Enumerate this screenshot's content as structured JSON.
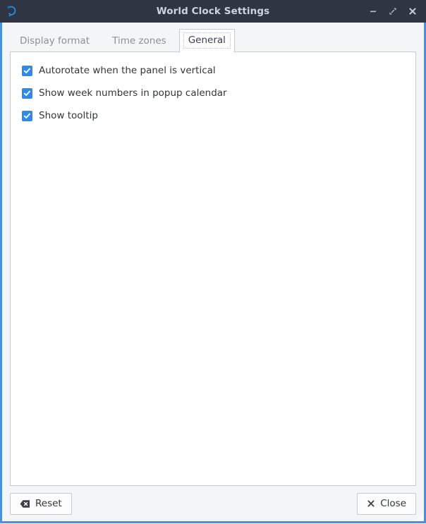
{
  "window": {
    "title": "World Clock Settings",
    "icon": "clock-app-icon",
    "accent_border_color": "#4a90e2",
    "titlebar_bg": "#2f3542",
    "titlebar_fg": "#cfd4dc",
    "controls": [
      {
        "name": "minimize",
        "glyph": "minimize-icon",
        "label": "Minimize"
      },
      {
        "name": "maximize",
        "glyph": "maximize-icon",
        "label": "Maximize"
      },
      {
        "name": "close",
        "glyph": "close-icon",
        "label": "Close"
      }
    ]
  },
  "tabs": [
    {
      "id": "display-format",
      "label": "Display format",
      "active": false
    },
    {
      "id": "time-zones",
      "label": "Time zones",
      "active": false
    },
    {
      "id": "general",
      "label": "General",
      "active": true
    }
  ],
  "general": {
    "checkbox_color": "#2f8ae8",
    "options": [
      {
        "id": "autorotate",
        "label": "Autorotate when the panel is vertical",
        "checked": true
      },
      {
        "id": "week-numbers",
        "label": "Show week numbers in popup calendar",
        "checked": true
      },
      {
        "id": "show-tooltip",
        "label": "Show tooltip",
        "checked": true
      }
    ]
  },
  "buttons": {
    "reset": {
      "label": "Reset",
      "icon": "backspace-erase-icon"
    },
    "close": {
      "label": "Close",
      "icon": "close-x-icon"
    }
  }
}
